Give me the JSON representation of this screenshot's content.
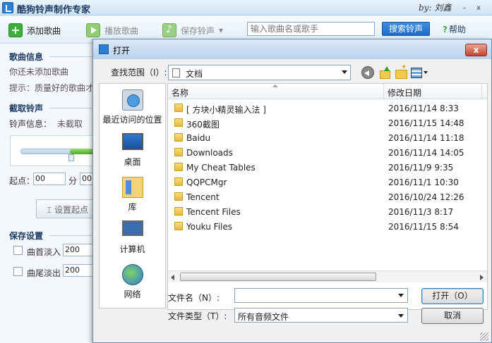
{
  "app": {
    "title": "酷狗铃声制作专家",
    "signature": "by: 刘鑫",
    "window_buttons": [
      "–",
      "x"
    ]
  },
  "toolbar": {
    "add_song": "添加歌曲",
    "play_song": "播放歌曲",
    "save_ringtone": "保存铃声",
    "save_dropdown": "▾",
    "search_placeholder": "输入歌曲名或歌手",
    "search_button": "搜索铃声",
    "help": "帮助"
  },
  "left": {
    "song_info_header": "歌曲信息",
    "no_song": "你还未添加歌曲",
    "tip": "提示：质量好的歌曲才",
    "cut_header": "截取铃声",
    "ringtone_info_label": "铃声信息：",
    "ringtone_info_value": "未截取",
    "start_label": "起点：",
    "start_min": "00",
    "min_unit": "分",
    "start_sec": "00",
    "set_start_button": "设置起点",
    "save_settings_header": "保存设置",
    "fade_in_label": "曲首淡入",
    "fade_in_value": "200",
    "fade_out_label": "曲尾淡出",
    "fade_out_value": "200"
  },
  "dialog": {
    "title": "打开",
    "close": "x",
    "look_in_label": "查找范围（I）:",
    "look_in_value": "文档",
    "places": [
      "最近访问的位置",
      "桌面",
      "库",
      "计算机",
      "网络"
    ],
    "columns": [
      "名称",
      "修改日期"
    ],
    "files": [
      {
        "name": "[ 方块小精灵输入法 ]",
        "date": "2016/11/14 8:33"
      },
      {
        "name": "360截图",
        "date": "2016/11/15 14:48"
      },
      {
        "name": "Baidu",
        "date": "2016/11/14 11:18"
      },
      {
        "name": "Downloads",
        "date": "2016/11/14 14:05"
      },
      {
        "name": "My Cheat Tables",
        "date": "2016/11/9 9:35"
      },
      {
        "name": "QQPCMgr",
        "date": "2016/11/1 10:30"
      },
      {
        "name": "Tencent",
        "date": "2016/10/24 12:26"
      },
      {
        "name": "Tencent Files",
        "date": "2016/11/3 8:17"
      },
      {
        "name": "Youku Files",
        "date": "2016/11/15 8:54"
      }
    ],
    "file_name_label": "文件名（N）:",
    "file_name_value": "",
    "file_type_label": "文件类型（T）:",
    "file_type_value": "所有音频文件",
    "open_button": "打开（O）",
    "cancel_button": "取消"
  }
}
